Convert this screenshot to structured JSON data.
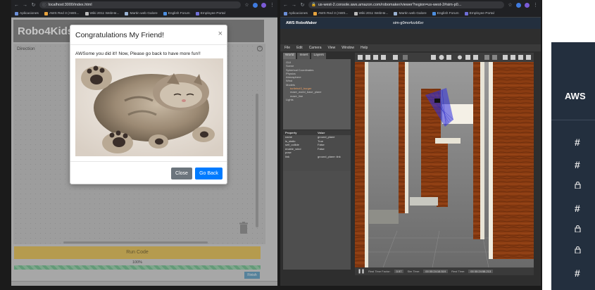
{
  "left_browser": {
    "url": "localhost:3000/index.html",
    "bookmarks": [
      "Aplicaciones",
      "AWS Red 3 (AWS...",
      "Wiki 2011 WebHe...",
      "Martin web Galore",
      "English Forum",
      "Employee Portal"
    ]
  },
  "app": {
    "title": "Robo4Kids",
    "direction_label": "Direction",
    "run_button": "Run Code",
    "progress_text": "100%",
    "progress_value": 1.0,
    "finish_button": "Finish"
  },
  "modal": {
    "title": "Congratulations My Friend!",
    "close_icon": "×",
    "message": "AWSome you did it!! Now, Please go back to have more fun!!",
    "image_alt": "sleeping kitten",
    "close_button": "Close",
    "back_button": "Go Back"
  },
  "mid_browser": {
    "url": "us-west-2.console.aws.amazon.com/robomaker/viewer?region=us-west-2#sim-p0...",
    "bookmarks": [
      "Aplicaciones",
      "AWS Red 3 (AWS...",
      "Wiki 2011 WebHe...",
      "Martin web Galore",
      "English Forum",
      "Employee Portal"
    ]
  },
  "robomaker": {
    "brand": "AWS RoboMaker",
    "sim_id": "sim-g0mo4zzb6xr",
    "menu": [
      "File",
      "Edit",
      "Camera",
      "View",
      "Window",
      "Help"
    ],
    "tabs": [
      "World",
      "Insert",
      "Layers"
    ],
    "tree": [
      "GUI",
      "Scene",
      "Spherical Coordinates",
      "Physics",
      "Atmosphere",
      "Wind",
      "Models",
      "turtlebot3_burger",
      "maze_world_base_plane",
      "maze_line",
      "Lights"
    ],
    "props_header": [
      "Property",
      "Value"
    ],
    "props": [
      {
        "k": "name",
        "v": "ground_plane"
      },
      {
        "k": "is_static",
        "v": "True"
      },
      {
        "k": "self_collide",
        "v": "False"
      },
      {
        "k": "enable_wind",
        "v": "False"
      },
      {
        "k": "pose",
        "v": ""
      },
      {
        "k": "link",
        "v": "ground_plane::link"
      }
    ],
    "status": {
      "rtf_label": "Real Time Factor:",
      "rtf": "0.97",
      "sim_label": "Sim Time:",
      "sim": "00 00:24:16.519",
      "real_label": "Real Time:",
      "real": "00 00:24:58.213"
    }
  },
  "aws_right": {
    "title": "AWS",
    "channels": [
      "#",
      "#",
      "lock",
      "#",
      "lock",
      "lock",
      "#"
    ]
  }
}
